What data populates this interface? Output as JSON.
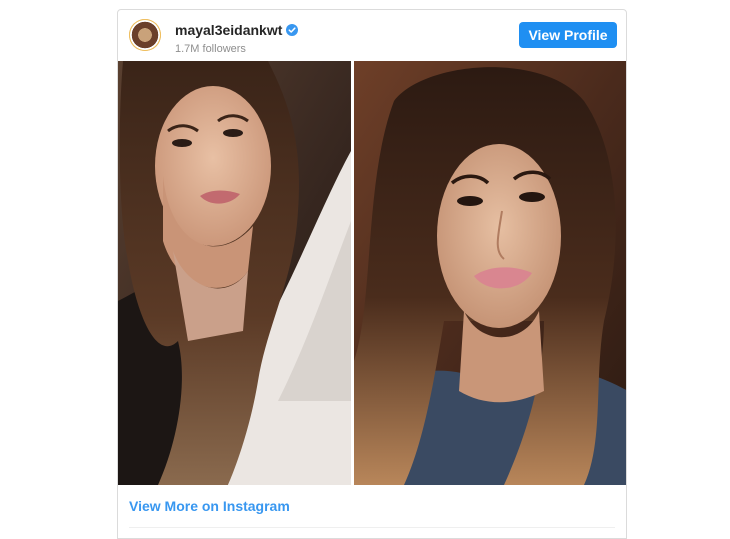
{
  "embed": {
    "username": "mayal3eidankwt",
    "followers": "1.7M followers",
    "verified_icon": "verified-badge-icon",
    "view_profile_label": "View Profile",
    "view_more_label": "View More on Instagram"
  },
  "colors": {
    "accent": "#1f8ff2",
    "link": "#3897f0",
    "muted": "#8e8e8e",
    "text": "#262626"
  }
}
